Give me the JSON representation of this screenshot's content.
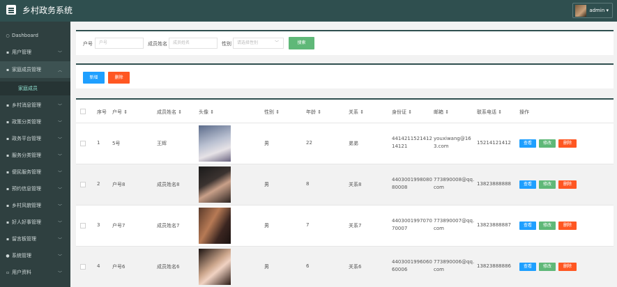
{
  "app": {
    "title": "乡村政务系统",
    "user": "admin ▾"
  },
  "sidebar": {
    "items": [
      {
        "icon": "○",
        "label": "Dashboard"
      },
      {
        "icon": "▪",
        "label": "用户管理"
      },
      {
        "icon": "▪",
        "label": "家庭成员管理"
      },
      {
        "icon": "▪",
        "label": "乡村消息管理"
      },
      {
        "icon": "▪",
        "label": "政策分类管理"
      },
      {
        "icon": "▪",
        "label": "政务平台管理"
      },
      {
        "icon": "▪",
        "label": "服务分类管理"
      },
      {
        "icon": "▪",
        "label": "便民服务管理"
      },
      {
        "icon": "▪",
        "label": "预约信息管理"
      },
      {
        "icon": "▪",
        "label": "乡村风貌管理"
      },
      {
        "icon": "▪",
        "label": "好人好事管理"
      },
      {
        "icon": "▪",
        "label": "留言板管理"
      },
      {
        "icon": "●",
        "label": "系统管理"
      },
      {
        "icon": "▫",
        "label": "用户资料"
      }
    ],
    "open_sub": "家庭成员"
  },
  "search": {
    "household_label": "户号",
    "household_placeholder": "户号",
    "name_label": "成员姓名",
    "name_placeholder": "成员姓名",
    "gender_label": "性别",
    "gender_placeholder": "请选择性别",
    "search_button": "搜索"
  },
  "actions": {
    "add": "新增",
    "delete": "删除"
  },
  "table": {
    "headers": {
      "index": "序号",
      "household": "户号 ⇕",
      "name": "成员姓名 ⇕",
      "photo": "头像 ⇕",
      "gender": "性别 ⇕",
      "age": "年龄 ⇕",
      "relation": "关系 ⇕",
      "id_card": "身份证 ⇕",
      "email": "邮箱 ⇕",
      "phone": "联系电话 ⇕",
      "ops": "操作"
    },
    "op_labels": {
      "view": "查看",
      "edit": "修改",
      "delete": "删除"
    },
    "rows": [
      {
        "index": "1",
        "household": "5号",
        "name": "王辉",
        "gender": "男",
        "age": "22",
        "relation": "弟弟",
        "id_card_1": "4414211521412",
        "id_card_2": "14121",
        "email_1": "youxiwang@16",
        "email_2": "3.com",
        "phone": "15214121412"
      },
      {
        "index": "2",
        "household": "户号8",
        "name": "成员姓名8",
        "gender": "男",
        "age": "8",
        "relation": "关系8",
        "id_card_1": "4403001998080",
        "id_card_2": "80008",
        "email_1": "773890008@qq.",
        "email_2": "com",
        "phone": "13823888888"
      },
      {
        "index": "3",
        "household": "户号7",
        "name": "成员姓名7",
        "gender": "男",
        "age": "7",
        "relation": "关系7",
        "id_card_1": "4403001997070",
        "id_card_2": "70007",
        "email_1": "773890007@qq.",
        "email_2": "com",
        "phone": "13823888887"
      },
      {
        "index": "4",
        "household": "户号6",
        "name": "成员姓名6",
        "gender": "男",
        "age": "6",
        "relation": "关系6",
        "id_card_1": "4403001996060",
        "id_card_2": "60006",
        "email_1": "773890006@qq.",
        "email_2": "com",
        "phone": "13823888886"
      }
    ]
  },
  "colors": {
    "topbar": "#2f4f4f",
    "sidebar": "#2f4040",
    "green": "#5fb878",
    "blue": "#1e9fff",
    "red": "#ff5722"
  }
}
